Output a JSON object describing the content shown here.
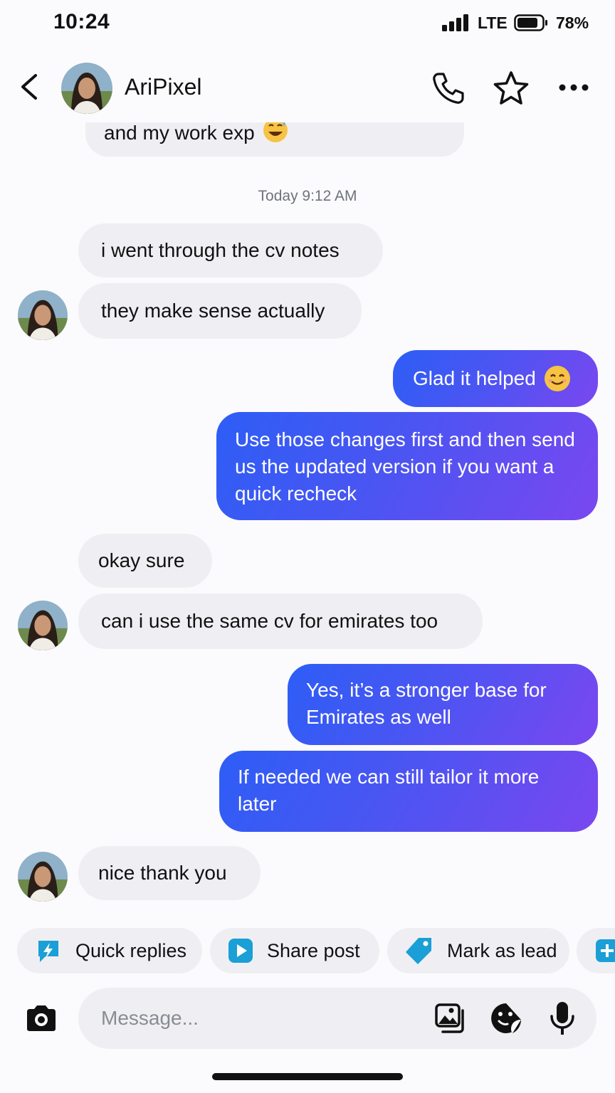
{
  "status_bar": {
    "time": "10:24",
    "network": "LTE",
    "battery": "78%"
  },
  "header": {
    "contact_name": "AriPixel",
    "icons": [
      "back-icon",
      "avatar",
      "phone-icon",
      "star-icon",
      "more-icon"
    ]
  },
  "messages": {
    "partial_top": "and my work exp",
    "timestamp": "Today 9:12 AM",
    "m1": "i went through the cv notes",
    "m2": "they make sense actually",
    "m3": "Glad it helped",
    "m4": "Use those changes first and then send us the updated version if you want a quick recheck",
    "m5": "okay sure",
    "m6": "can i use the same cv for emirates too",
    "m7": "Yes, it’s a stronger base for Emirates as well",
    "m8": "If needed we can still tailor it more later",
    "m9": "nice thank you"
  },
  "chips": {
    "quick_replies": "Quick replies",
    "share_post": "Share post",
    "mark_as_lead": "Mark as lead"
  },
  "composer": {
    "placeholder": "Message..."
  },
  "colors": {
    "outgoing_start": "#2d5ef6",
    "outgoing_end": "#7a47f0",
    "incoming": "#efeff3",
    "chip_accent": "#1a9fd6"
  }
}
